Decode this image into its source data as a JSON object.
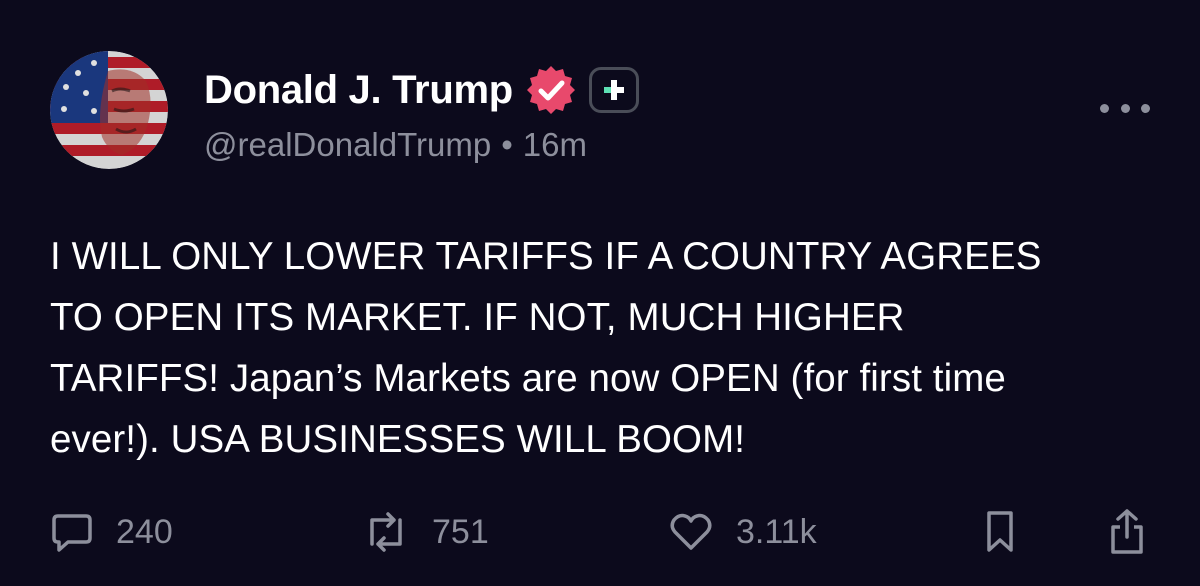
{
  "post": {
    "author": {
      "display_name": "Donald J. Trump",
      "handle": "@realDonaldTrump",
      "separator": "•",
      "timestamp": "16m",
      "avatar_icon": "avatar-flag-portrait",
      "verified_icon": "verified-badge-icon",
      "plus_icon": "plus-badge-icon"
    },
    "more_icon": "more-options-icon",
    "text_lines": [
      "I WILL ONLY LOWER TARIFFS IF A COUNTRY AGREES",
      "TO OPEN ITS MARKET. IF NOT, MUCH HIGHER",
      "TARIFFS! Japan’s Markets are now OPEN (for first time",
      "ever!). USA BUSINESSES WILL BOOM!"
    ],
    "actions": {
      "replies": {
        "icon": "reply-icon",
        "count": "240"
      },
      "reposts": {
        "icon": "repost-icon",
        "count": "751"
      },
      "likes": {
        "icon": "heart-icon",
        "count": "3.11k"
      },
      "bookmark": {
        "icon": "bookmark-icon"
      },
      "share": {
        "icon": "share-icon"
      }
    }
  },
  "colors": {
    "background": "#0c0a1c",
    "text_primary": "#ffffff",
    "text_secondary": "#8d8f9c",
    "verified_pink": "#e8496c",
    "plus_accent": "#5ee0b4"
  }
}
